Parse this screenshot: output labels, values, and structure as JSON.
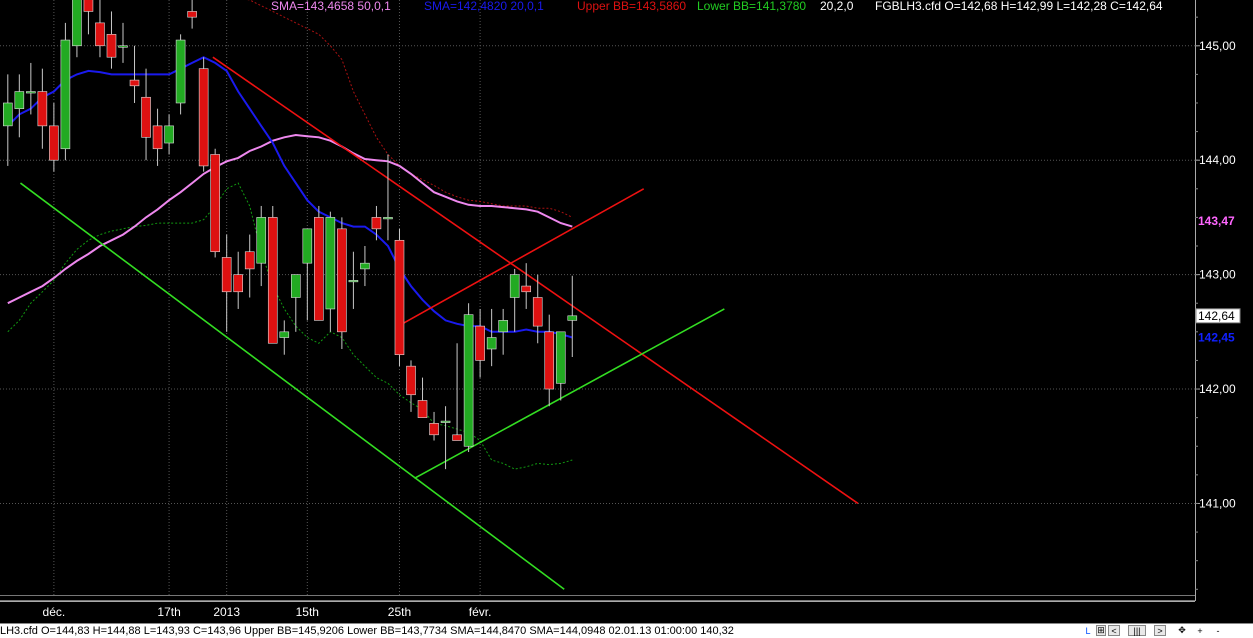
{
  "chart_data": {
    "type": "candlestick",
    "symbol": "FGBLH3.cfd",
    "header": {
      "sma50": "SMA=143,4658  50,0,1",
      "sma20": "SMA=142,4820  20,0,1",
      "upper_bb": "Upper BB=143,5860",
      "lower_bb": "Lower BB=141,3780",
      "bb_params": "20,2,0",
      "ohlc": "FGBLH3.cfd O=142,68 H=142,99 L=142,28 C=142,64"
    },
    "ylim": [
      140.2,
      145.4
    ],
    "y_ticks": [
      {
        "value": 145.0,
        "label": "145,00"
      },
      {
        "value": 144.0,
        "label": "144,00"
      },
      {
        "value": 143.0,
        "label": "143,00"
      },
      {
        "value": 142.0,
        "label": "142,00"
      },
      {
        "value": 141.0,
        "label": "141,00"
      }
    ],
    "x_labels": [
      {
        "i": 4,
        "label": "déc."
      },
      {
        "i": 14,
        "label": "17th"
      },
      {
        "i": 19,
        "label": "2013"
      },
      {
        "i": 26,
        "label": "15th"
      },
      {
        "i": 34,
        "label": "25th"
      },
      {
        "i": 41,
        "label": "févr."
      }
    ],
    "price_flags": [
      {
        "value": 143.47,
        "label": "143,47",
        "color": "#ff66ff",
        "boxed": false
      },
      {
        "value": 142.64,
        "label": "142,64",
        "color": "#000000",
        "boxed": true
      },
      {
        "value": 142.45,
        "label": "142,45",
        "color": "#1020ff",
        "boxed": false
      }
    ],
    "candles": [
      [
        144.3,
        144.75,
        143.95,
        144.5
      ],
      [
        144.45,
        144.75,
        144.2,
        144.6
      ],
      [
        144.6,
        144.85,
        144.4,
        144.6
      ],
      [
        144.6,
        144.8,
        144.1,
        144.3
      ],
      [
        144.3,
        144.5,
        143.9,
        144.0
      ],
      [
        144.1,
        145.2,
        144.0,
        145.05
      ],
      [
        145.0,
        145.6,
        144.9,
        145.5
      ],
      [
        145.5,
        145.7,
        145.1,
        145.3
      ],
      [
        145.2,
        145.4,
        144.9,
        145.0
      ],
      [
        145.1,
        145.3,
        144.8,
        144.9
      ],
      [
        145.0,
        145.2,
        144.85,
        145.0
      ],
      [
        144.7,
        145.0,
        144.5,
        144.65
      ],
      [
        144.55,
        144.8,
        144.0,
        144.2
      ],
      [
        144.3,
        144.45,
        143.95,
        144.1
      ],
      [
        144.15,
        144.4,
        144.05,
        144.3
      ],
      [
        144.5,
        145.1,
        144.4,
        145.05
      ],
      [
        145.3,
        145.45,
        145.15,
        145.25
      ],
      [
        144.8,
        144.9,
        143.9,
        143.95
      ],
      [
        144.05,
        144.1,
        143.15,
        143.2
      ],
      [
        143.15,
        143.35,
        142.5,
        142.85
      ],
      [
        143.0,
        143.2,
        142.7,
        142.85
      ],
      [
        143.2,
        143.35,
        142.8,
        143.05
      ],
      [
        143.1,
        143.6,
        142.9,
        143.5
      ],
      [
        143.5,
        143.6,
        142.4,
        142.4
      ],
      [
        142.45,
        142.6,
        142.3,
        142.5
      ],
      [
        142.8,
        143.0,
        142.5,
        143.0
      ],
      [
        143.1,
        143.4,
        142.6,
        143.4
      ],
      [
        143.5,
        143.6,
        142.6,
        142.6
      ],
      [
        142.7,
        143.55,
        142.5,
        143.5
      ],
      [
        143.4,
        143.5,
        142.35,
        142.5
      ],
      [
        142.95,
        143.2,
        142.7,
        142.95
      ],
      [
        143.05,
        143.25,
        142.9,
        143.1
      ],
      [
        143.5,
        143.6,
        143.3,
        143.4
      ],
      [
        143.5,
        144.05,
        143.3,
        143.5
      ],
      [
        143.3,
        143.4,
        142.2,
        142.3
      ],
      [
        142.2,
        142.25,
        141.8,
        141.95
      ],
      [
        141.9,
        142.1,
        141.75,
        141.75
      ],
      [
        141.7,
        141.8,
        141.55,
        141.6
      ],
      [
        141.72,
        141.85,
        141.3,
        141.72
      ],
      [
        141.6,
        142.4,
        141.55,
        141.55
      ],
      [
        141.5,
        142.75,
        141.45,
        142.65
      ],
      [
        142.55,
        142.7,
        142.1,
        142.25
      ],
      [
        142.35,
        142.7,
        142.2,
        142.45
      ],
      [
        142.5,
        142.7,
        142.3,
        142.6
      ],
      [
        142.8,
        143.05,
        142.5,
        143.0
      ],
      [
        142.9,
        143.1,
        142.7,
        142.85
      ],
      [
        142.8,
        143.0,
        142.4,
        142.55
      ],
      [
        142.5,
        142.65,
        141.85,
        142.0
      ],
      [
        142.05,
        142.25,
        141.9,
        142.5
      ],
      [
        142.6,
        142.99,
        142.28,
        142.64
      ]
    ],
    "sma20": [
      144.3,
      144.4,
      144.45,
      144.55,
      144.6,
      144.7,
      144.75,
      144.78,
      144.77,
      144.75,
      144.75,
      144.75,
      144.75,
      144.75,
      144.75,
      144.8,
      144.85,
      144.9,
      144.85,
      144.78,
      144.6,
      144.45,
      144.3,
      144.15,
      143.95,
      143.8,
      143.65,
      143.55,
      143.5,
      143.45,
      143.42,
      143.42,
      143.35,
      143.25,
      143.05,
      142.9,
      142.78,
      142.68,
      142.6,
      142.57,
      142.55,
      142.55,
      142.5,
      142.5,
      142.5,
      142.52,
      142.5,
      142.5,
      142.48,
      142.45
    ],
    "sma50_start": 0,
    "sma50": [
      142.75,
      142.8,
      142.85,
      142.9,
      142.97,
      143.05,
      143.12,
      143.18,
      143.25,
      143.3,
      143.35,
      143.42,
      143.5,
      143.57,
      143.65,
      143.72,
      143.8,
      143.88,
      143.94,
      143.99,
      144.02,
      144.08,
      144.12,
      144.17,
      144.2,
      144.22,
      144.21,
      144.2,
      144.17,
      144.12,
      144.06,
      144.01,
      144.0,
      143.99,
      143.95,
      143.88,
      143.8,
      143.72,
      143.68,
      143.64,
      143.61,
      143.6,
      143.6,
      143.59,
      143.58,
      143.57,
      143.55,
      143.5,
      143.45,
      143.42
    ],
    "upper_bb_start": 16,
    "upper_bb": [
      145.6,
      145.55,
      145.5,
      145.45,
      145.42,
      145.4,
      145.35,
      145.3,
      145.25,
      145.2,
      145.15,
      145.1,
      145.0,
      144.88,
      144.6,
      144.4,
      144.2,
      144.05,
      143.95,
      143.88,
      143.83,
      143.78,
      143.72,
      143.68,
      143.65,
      143.64,
      143.62,
      143.6,
      143.6,
      143.6,
      143.58,
      143.58,
      143.55,
      143.5
    ],
    "lower_bb": [
      142.5,
      142.6,
      142.75,
      142.85,
      142.95,
      143.1,
      143.22,
      143.3,
      143.35,
      143.38,
      143.4,
      143.42,
      143.43,
      143.45,
      143.45,
      143.45,
      143.45,
      143.48,
      143.6,
      143.75,
      143.8,
      143.6,
      143.2,
      142.9,
      142.7,
      142.55,
      142.45,
      142.4,
      142.5,
      142.45,
      142.3,
      142.2,
      142.1,
      142.05,
      141.95,
      141.88,
      141.82,
      141.7,
      141.68,
      141.65,
      141.62,
      141.55,
      141.38,
      141.35,
      141.3,
      141.32,
      141.35,
      141.34,
      141.35,
      141.38
    ],
    "trendlines": [
      {
        "color": "#ee1111",
        "from": [
          17.8,
          144.9
        ],
        "to": [
          73.8,
          141.0
        ]
      },
      {
        "color": "#ee1111",
        "from": [
          33.9,
          142.55
        ],
        "to": [
          55.2,
          143.75
        ]
      },
      {
        "color": "#33dd22",
        "from": [
          1.1,
          143.8
        ],
        "to": [
          48.3,
          140.25
        ]
      },
      {
        "color": "#33dd22",
        "from": [
          35.3,
          141.22
        ],
        "to": [
          62.2,
          142.7
        ]
      }
    ]
  },
  "statusbar": {
    "text": "LH3.cfd O=144,83 H=144,88 L=143,93 C=143,96  Upper BB=145,9206 Lower BB=143,7734 SMA=144,8470 SMA=144,0948  02.01.13 01:00:00 140,32",
    "l_label": "L",
    "buttons": [
      "⊞",
      "<",
      "|||",
      ">",
      "✥",
      "+",
      "-"
    ]
  },
  "colors": {
    "background": "#000000",
    "up": "#22aa22",
    "down": "#dd1111",
    "wick": "#c8c8c8",
    "grid": "#555555",
    "sma20": "#1a1aee",
    "sma50": "#ee88ee",
    "upper_bb": "#aa1111",
    "lower_bb": "#119911",
    "axis_text": "#ffffff"
  }
}
